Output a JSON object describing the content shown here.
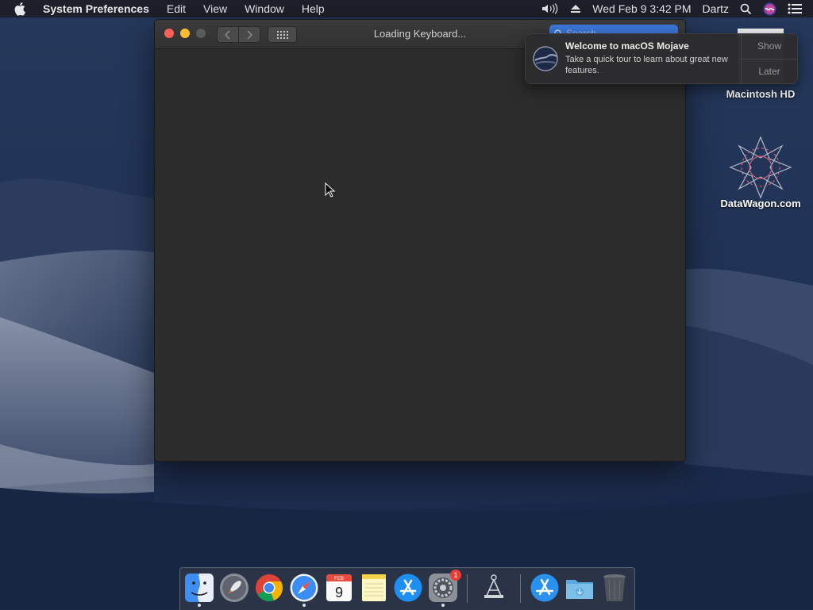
{
  "menubar": {
    "app_name": "System Preferences",
    "menus": [
      "Edit",
      "View",
      "Window",
      "Help"
    ],
    "clock": "Wed Feb 9  3:42 PM",
    "user": "Dartz"
  },
  "window": {
    "title": "Loading Keyboard...",
    "search_placeholder": "Search"
  },
  "notification": {
    "title": "Welcome to macOS Mojave",
    "body": "Take a quick tour to learn about great new features.",
    "show_label": "Show",
    "later_label": "Later"
  },
  "desktop": {
    "icons": [
      {
        "label": "Macintosh HD",
        "icon": "hard-drive-icon"
      },
      {
        "label": "DataWagon.com",
        "icon": "datawagon-icon"
      }
    ]
  },
  "dock": {
    "items": [
      {
        "name": "Finder",
        "icon": "finder-icon",
        "running": true
      },
      {
        "name": "Launchpad",
        "icon": "launchpad-icon",
        "running": false
      },
      {
        "name": "Google Chrome",
        "icon": "chrome-icon",
        "running": false
      },
      {
        "name": "Safari",
        "icon": "safari-icon",
        "running": true
      },
      {
        "name": "Calendar",
        "icon": "calendar-icon",
        "running": false,
        "month": "FEB",
        "day": "9"
      },
      {
        "name": "Notes",
        "icon": "notes-icon",
        "running": false
      },
      {
        "name": "App Store",
        "icon": "app-store-icon",
        "running": false
      },
      {
        "name": "System Preferences",
        "icon": "system-preferences-icon",
        "running": true,
        "badge": "1"
      },
      {
        "name": "Network Utility",
        "icon": "network-utility-icon",
        "running": false
      },
      {
        "name": "Applications",
        "icon": "applications-folder-icon",
        "running": false
      },
      {
        "name": "Downloads",
        "icon": "downloads-folder-icon",
        "running": false
      },
      {
        "name": "Trash",
        "icon": "trash-icon",
        "running": false
      }
    ]
  },
  "colors": {
    "accent": "#3b75d6",
    "close": "#fc5f57",
    "minimize": "#fdbc2e",
    "badge": "#f03a36"
  }
}
